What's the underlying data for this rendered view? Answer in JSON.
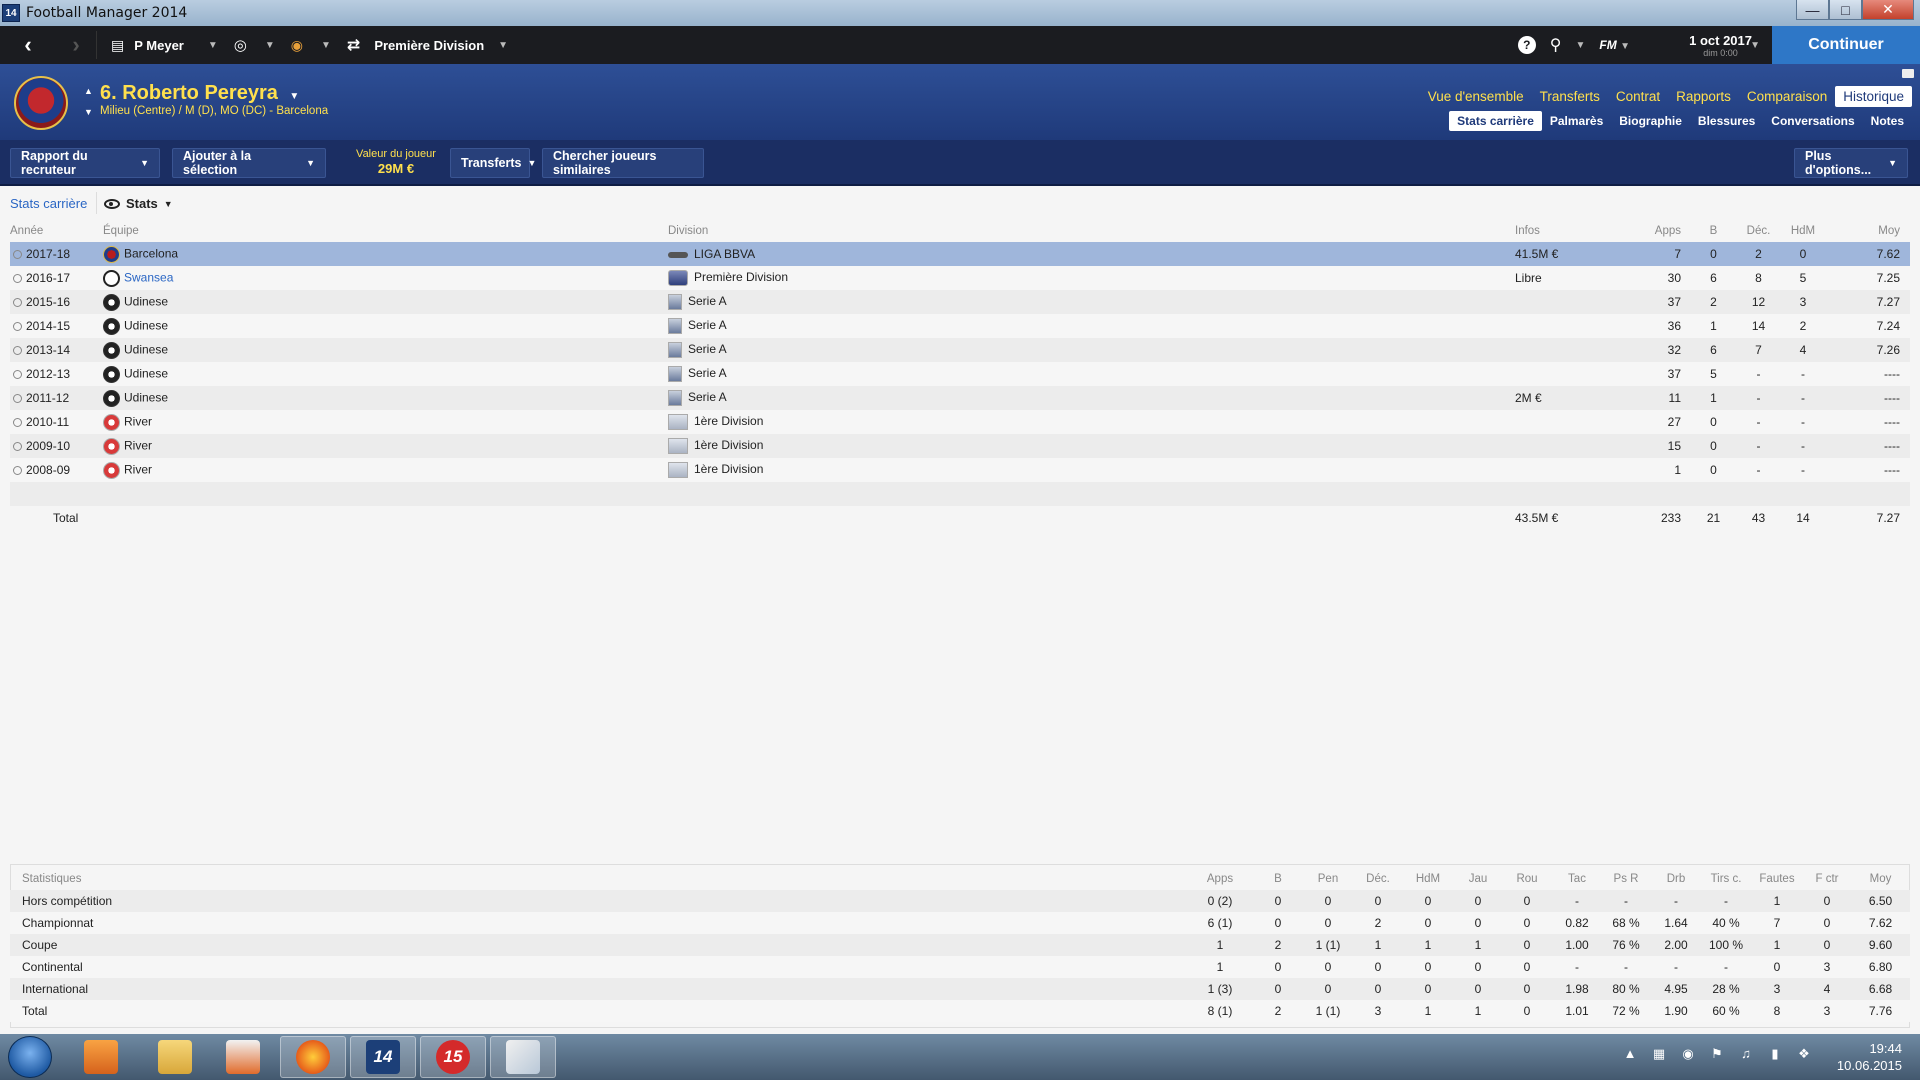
{
  "window": {
    "title": "Football Manager 2014",
    "icon_text": "14"
  },
  "toolbar": {
    "manager": "P Meyer",
    "competition": "Première Division",
    "date": "1 oct 2017",
    "time": "dim 0:00",
    "fm_label": "FM",
    "continue_label": "Continuer"
  },
  "player": {
    "name": "6. Roberto Pereyra",
    "position": "Milieu (Centre) / M (D), MO (DC) - Barcelona"
  },
  "main_tabs": [
    "Vue d'ensemble",
    "Transferts",
    "Contrat",
    "Rapports",
    "Comparaison",
    "Historique"
  ],
  "sub_tabs": [
    "Stats carrière",
    "Palmarès",
    "Biographie",
    "Blessures",
    "Conversations",
    "Notes"
  ],
  "actions": {
    "scout_report": "Rapport du recruteur",
    "add_to_selection": "Ajouter à la sélection",
    "value_label": "Valeur du joueur",
    "value": "29M €",
    "transfers": "Transferts",
    "similar": "Chercher joueurs similaires",
    "more_options": "Plus d'options..."
  },
  "view": {
    "breadcrumb": "Stats carrière",
    "dropdown": "Stats"
  },
  "career": {
    "headers": [
      "Année",
      "Équipe",
      "Division",
      "Infos",
      "Apps",
      "B",
      "Déc.",
      "HdM",
      "Moy"
    ],
    "rows": [
      [
        "2017-18",
        "Barcelona",
        "LIGA BBVA",
        "41.5M €",
        "7",
        "0",
        "2",
        "0",
        "7.62"
      ],
      [
        "2016-17",
        "Swansea",
        "Première Division",
        "Libre",
        "30",
        "6",
        "8",
        "5",
        "7.25"
      ],
      [
        "2015-16",
        "Udinese",
        "Serie A",
        "",
        "37",
        "2",
        "12",
        "3",
        "7.27"
      ],
      [
        "2014-15",
        "Udinese",
        "Serie A",
        "",
        "36",
        "1",
        "14",
        "2",
        "7.24"
      ],
      [
        "2013-14",
        "Udinese",
        "Serie A",
        "",
        "32",
        "6",
        "7",
        "4",
        "7.26"
      ],
      [
        "2012-13",
        "Udinese",
        "Serie A",
        "",
        "37",
        "5",
        "-",
        "-",
        "----"
      ],
      [
        "2011-12",
        "Udinese",
        "Serie A",
        "2M €",
        "11",
        "1",
        "-",
        "-",
        "----"
      ],
      [
        "2010-11",
        "River",
        "1ère Division",
        "",
        "27",
        "0",
        "-",
        "-",
        "----"
      ],
      [
        "2009-10",
        "River",
        "1ère Division",
        "",
        "15",
        "0",
        "-",
        "-",
        "----"
      ],
      [
        "2008-09",
        "River",
        "1ère Division",
        "",
        "1",
        "0",
        "-",
        "-",
        "----"
      ]
    ],
    "total": [
      "Total",
      "43.5M €",
      "233",
      "21",
      "43",
      "14",
      "7.27"
    ]
  },
  "stats": {
    "headers": [
      "Statistiques",
      "Apps",
      "B",
      "Pen",
      "Déc.",
      "HdM",
      "Jau",
      "Rou",
      "Tac",
      "Ps R",
      "Drb",
      "Tirs c.",
      "Fautes",
      "F ctr",
      "Moy"
    ],
    "rows": [
      [
        "Hors compétition",
        "0 (2)",
        "0",
        "0",
        "0",
        "0",
        "0",
        "0",
        "-",
        "-",
        "-",
        "-",
        "1",
        "0",
        "6.50"
      ],
      [
        "Championnat",
        "6 (1)",
        "0",
        "0",
        "2",
        "0",
        "0",
        "0",
        "0.82",
        "68 %",
        "1.64",
        "40 %",
        "7",
        "0",
        "7.62"
      ],
      [
        "Coupe",
        "1",
        "2",
        "1 (1)",
        "1",
        "1",
        "1",
        "0",
        "1.00",
        "76 %",
        "2.00",
        "100 %",
        "1",
        "0",
        "9.60"
      ],
      [
        "Continental",
        "1",
        "0",
        "0",
        "0",
        "0",
        "0",
        "0",
        "-",
        "-",
        "-",
        "-",
        "0",
        "3",
        "6.80"
      ],
      [
        "International",
        "1 (3)",
        "0",
        "0",
        "0",
        "0",
        "0",
        "0",
        "1.98",
        "80 %",
        "4.95",
        "28 %",
        "3",
        "4",
        "6.68"
      ],
      [
        "Total",
        "8 (1)",
        "2",
        "1 (1)",
        "3",
        "1",
        "1",
        "0",
        "1.01",
        "72 %",
        "1.90",
        "60 %",
        "8",
        "3",
        "7.76"
      ]
    ]
  },
  "taskbar": {
    "time": "19:44",
    "date": "10.06.2015",
    "fm15_label": "15",
    "fm14_label": "14"
  }
}
